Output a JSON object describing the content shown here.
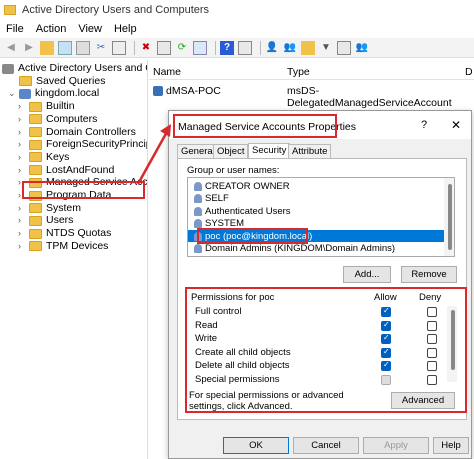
{
  "window": {
    "title": "Active Directory Users and Computers"
  },
  "menu": [
    "File",
    "Action",
    "View",
    "Help"
  ],
  "tree": {
    "root": "Active Directory Users and Com",
    "items": [
      {
        "label": "Saved Queries",
        "indent": 1,
        "type": "folder"
      },
      {
        "label": "kingdom.local",
        "indent": 1,
        "type": "domain"
      },
      {
        "label": "Builtin",
        "indent": 2,
        "type": "folder"
      },
      {
        "label": "Computers",
        "indent": 2,
        "type": "folder"
      },
      {
        "label": "Domain Controllers",
        "indent": 2,
        "type": "folder"
      },
      {
        "label": "ForeignSecurityPrincipal:",
        "indent": 2,
        "type": "folder"
      },
      {
        "label": "Keys",
        "indent": 2,
        "type": "folder"
      },
      {
        "label": "LostAndFound",
        "indent": 2,
        "type": "folder"
      },
      {
        "label": "Managed Service Accour",
        "indent": 2,
        "type": "folder",
        "selected": true
      },
      {
        "label": "Program Data",
        "indent": 2,
        "type": "folder"
      },
      {
        "label": "System",
        "indent": 2,
        "type": "folder"
      },
      {
        "label": "Users",
        "indent": 2,
        "type": "folder"
      },
      {
        "label": "NTDS Quotas",
        "indent": 2,
        "type": "folder"
      },
      {
        "label": "TPM Devices",
        "indent": 2,
        "type": "folder"
      }
    ]
  },
  "list": {
    "col_name": "Name",
    "col_type": "Type",
    "col_d": "D",
    "row": {
      "name": "dMSA-POC",
      "type": "msDS-DelegatedManagedServiceAccount"
    }
  },
  "dialog": {
    "title": "Managed Service Accounts Properties",
    "help": "?",
    "close": "✕",
    "tabs": [
      "General",
      "Object",
      "Security",
      "Attribute Editor"
    ],
    "group_label": "Group or user names:",
    "users": [
      "CREATOR OWNER",
      "SELF",
      "Authenticated Users",
      "SYSTEM",
      "poc (poc@kingdom.local)",
      "Domain Admins (KINGDOM\\Domain Admins)"
    ],
    "add_button": "Add...",
    "remove_button": "Remove",
    "perm_label": "Permissions for poc",
    "allow_label": "Allow",
    "deny_label": "Deny",
    "permissions": [
      {
        "name": "Full control",
        "allow": true,
        "deny": false
      },
      {
        "name": "Read",
        "allow": true,
        "deny": false
      },
      {
        "name": "Write",
        "allow": true,
        "deny": false
      },
      {
        "name": "Create all child objects",
        "allow": true,
        "deny": false
      },
      {
        "name": "Delete all child objects",
        "allow": true,
        "deny": false
      },
      {
        "name": "Special permissions",
        "allow": false,
        "deny": false
      }
    ],
    "special_note": "For special permissions or advanced settings, click Advanced.",
    "advanced_button": "Advanced",
    "ok_button": "OK",
    "cancel_button": "Cancel",
    "apply_button": "Apply",
    "help_button": "Help"
  },
  "colors": {
    "highlight": "#d8292c",
    "selection": "#0078d7",
    "checkbox": "#0060c0"
  }
}
